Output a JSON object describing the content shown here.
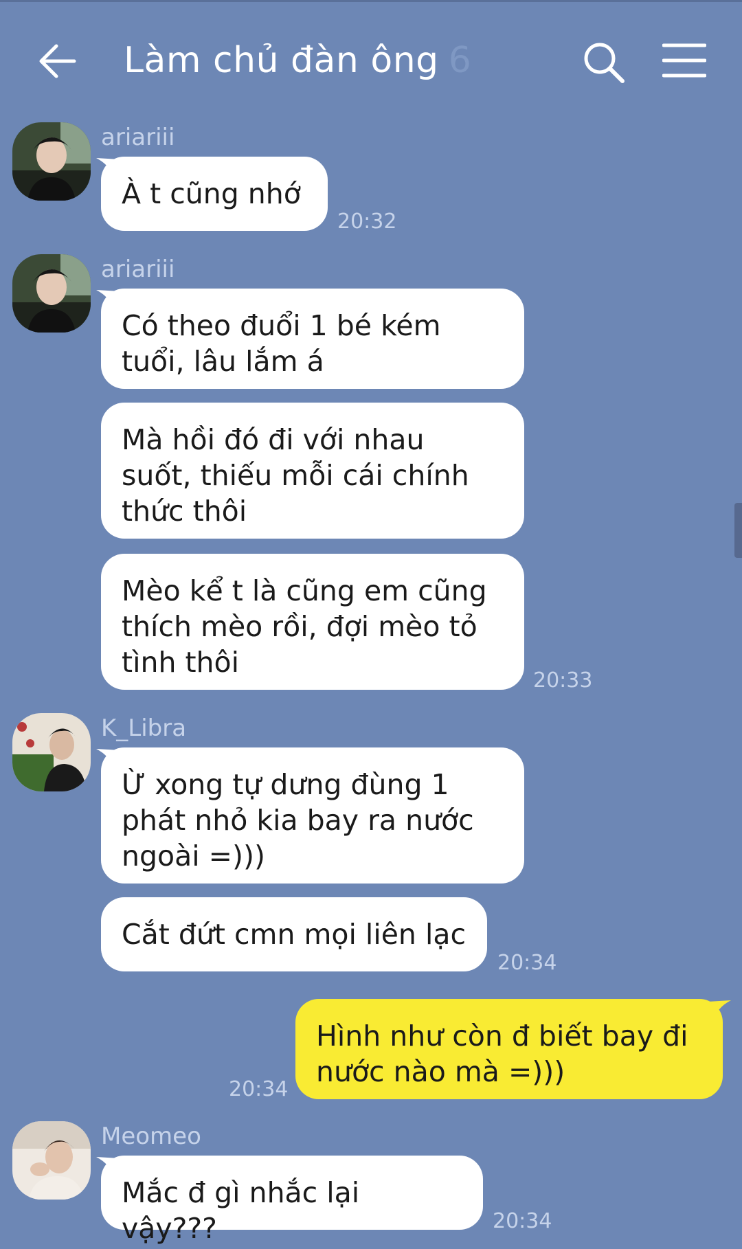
{
  "header": {
    "title": "Làm chủ đàn ông",
    "member_count": "6",
    "icons": [
      "back-arrow-icon",
      "search-icon",
      "menu-icon"
    ]
  },
  "colors": {
    "background": "#6d87b5",
    "bubble_incoming": "#ffffff",
    "bubble_outgoing": "#f9eb33",
    "meta_text": "#c6d3ea"
  },
  "messages": [
    {
      "sender": "ariariii",
      "lines": [
        "À t cũng nhớ"
      ],
      "time": "20:32"
    },
    {
      "sender": "ariariii",
      "lines": [
        "Có theo đuổi 1 bé kém",
        "tuổi, lâu lắm á"
      ]
    },
    {
      "lines": [
        "Mà hồi đó đi với nhau",
        "suốt, thiếu mỗi cái chính",
        "thức thôi"
      ]
    },
    {
      "lines": [
        "Mèo kể t là cũng em cũng",
        "thích mèo rồi, đợi mèo tỏ",
        "tình thôi"
      ],
      "time": "20:33"
    },
    {
      "sender": "K_Libra",
      "lines": [
        "Ừ xong tự dưng đùng 1",
        "phát nhỏ kia bay ra nước",
        "ngoài =)))"
      ]
    },
    {
      "lines": [
        "Cắt đứt cmn mọi liên lạc"
      ],
      "time": "20:34"
    },
    {
      "mine": true,
      "lines": [
        "Hình như còn đ biết bay đi",
        "nước nào mà =)))"
      ],
      "time": "20:34"
    },
    {
      "sender": "Meomeo",
      "lines": [
        "Mắc đ gì nhắc lại vậy???"
      ],
      "time": "20:34"
    }
  ]
}
